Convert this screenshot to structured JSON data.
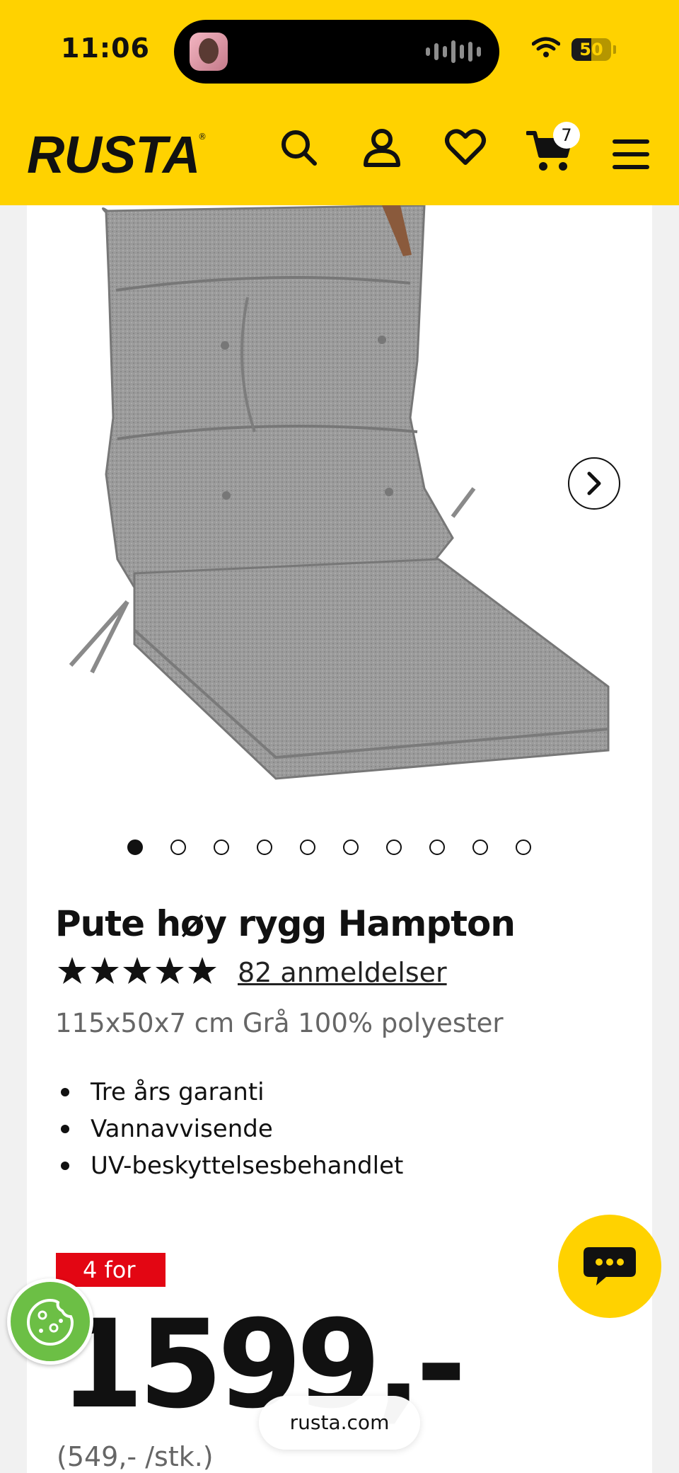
{
  "status_bar": {
    "time": "11:06",
    "battery_level": "50",
    "battery_fraction": 0.5,
    "icons": [
      "caller-avatar-icon",
      "audio-wave-icon",
      "wifi-icon",
      "battery-icon"
    ]
  },
  "header": {
    "logo": "RUSTA",
    "logo_mark": "®",
    "icons": [
      "search-icon",
      "account-icon",
      "heart-icon",
      "cart-icon",
      "menu-icon"
    ],
    "cart_count": "7",
    "colors": {
      "brand_yellow": "#ffd200",
      "text": "#111111"
    }
  },
  "gallery": {
    "image_alt": "grey-highback-seat-cushion",
    "total_images": 10,
    "active_index": 0,
    "next_icon": "chevron-right-icon"
  },
  "product": {
    "title": "Pute høy rygg Hampton",
    "rating": 5,
    "rating_max": 5,
    "reviews": "82 anmeldelser",
    "spec": "115x50x7 cm Grå 100% polyester",
    "features": [
      "Tre års garanti",
      "Vannavvisende",
      "UV-beskyttelsesbehandlet"
    ]
  },
  "pricing": {
    "offer": "4 for",
    "price": "1599,-",
    "unit_price": "(549,- /stk.)",
    "offer_color": "#e30613"
  },
  "floating": {
    "chat_icon": "chat-bubble-icon",
    "cookie_icon": "cookie-icon",
    "url": "rusta.com"
  }
}
